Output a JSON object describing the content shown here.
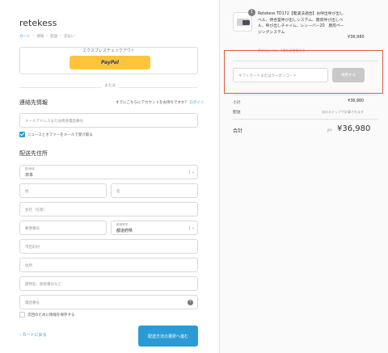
{
  "store": {
    "name": "retekess"
  },
  "breadcrumb": {
    "items": [
      "カート",
      "情報",
      "配送",
      "支払い"
    ]
  },
  "express": {
    "title": "エクスプレスチェックアウト",
    "paypal_label": "PayPal"
  },
  "divider": {
    "text": "または"
  },
  "contact": {
    "title": "連絡先情報",
    "login_prompt": "すでにこちらにアカウントをお持ちですか？",
    "login_link": "ログイン",
    "email_placeholder": "メールアドレスまたは携帯電話番号",
    "newsletter_label": "ニュースとオファーをメールで受け取る",
    "newsletter_checked": true
  },
  "shipping": {
    "title": "配送先住所",
    "country_label": "国/地域",
    "country_value": "日本",
    "last_name_placeholder": "姓",
    "first_name_placeholder": "名",
    "company_placeholder": "会社（任意）",
    "postal_placeholder": "郵便番号",
    "prefecture_label": "都道府県",
    "prefecture_value": "都道府県",
    "city_placeholder": "市区町村",
    "address_placeholder": "住所",
    "building_placeholder": "建物名、部屋番号など",
    "phone_placeholder": "電話番号",
    "save_label": "次回のために情報を保存する",
    "save_checked": false
  },
  "footer": {
    "back_label": "‹ カートに戻る",
    "next_label": "配送方法の選択へ進む"
  },
  "summary": {
    "quantity": "1",
    "product_name": "Retekess TD172【電波法適合】お呼出呼び出しベル、待合室呼び出しシステム、厨房呼び出しベル、呼び出しチャイム、レシーバー20　厨房ページングシステム",
    "product_variant": "呼び出しベル、1個の送信機付き",
    "product_price": "¥36,980",
    "coupon_placeholder": "ギフトカードまたはクーポンコード",
    "coupon_button": "適用する",
    "subtotal_label": "小計",
    "subtotal_value": "¥36,980",
    "shipping_label": "配送",
    "shipping_value": "次のステップで計算されます",
    "total_label": "合計",
    "total_currency": "JPY",
    "total_value": "¥36,980"
  },
  "colors": {
    "accent": "#2a9bd6",
    "paypal": "#ffc439",
    "highlight": "#e05a45"
  }
}
